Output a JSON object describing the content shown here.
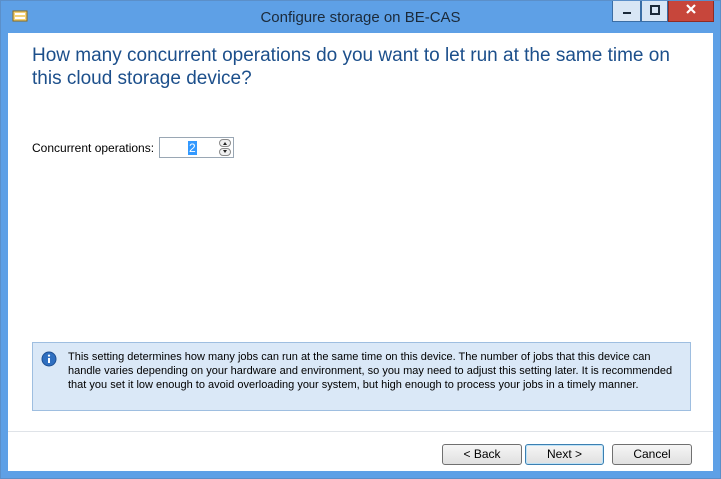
{
  "window": {
    "title": "Configure storage on BE-CAS"
  },
  "main": {
    "heading": "How many concurrent operations do you want to let run at the same time on this cloud storage device?",
    "concurrent_label": "Concurrent operations:",
    "concurrent_value": "2"
  },
  "info": {
    "text": "This setting determines how many jobs can run at the same time on this device. The number of jobs that this device can handle varies depending on your hardware and environment, so you may need to adjust this setting later. It is recommended that you set it low enough to avoid overloading your system, but high enough to process your jobs in a timely manner."
  },
  "buttons": {
    "back": "< Back",
    "next": "Next >",
    "cancel": "Cancel"
  },
  "icons": {
    "app": "storage-wizard-icon",
    "minimize": "minimize-icon",
    "maximize": "maximize-icon",
    "close": "close-icon",
    "info": "info-icon",
    "spin_up": "arrow-up-icon",
    "spin_down": "arrow-down-icon"
  },
  "colors": {
    "title_bar": "#5ea0e6",
    "heading": "#1c4f8b",
    "close_button": "#c7463b",
    "info_background": "#dae8f7",
    "selection": "#3399ff"
  }
}
